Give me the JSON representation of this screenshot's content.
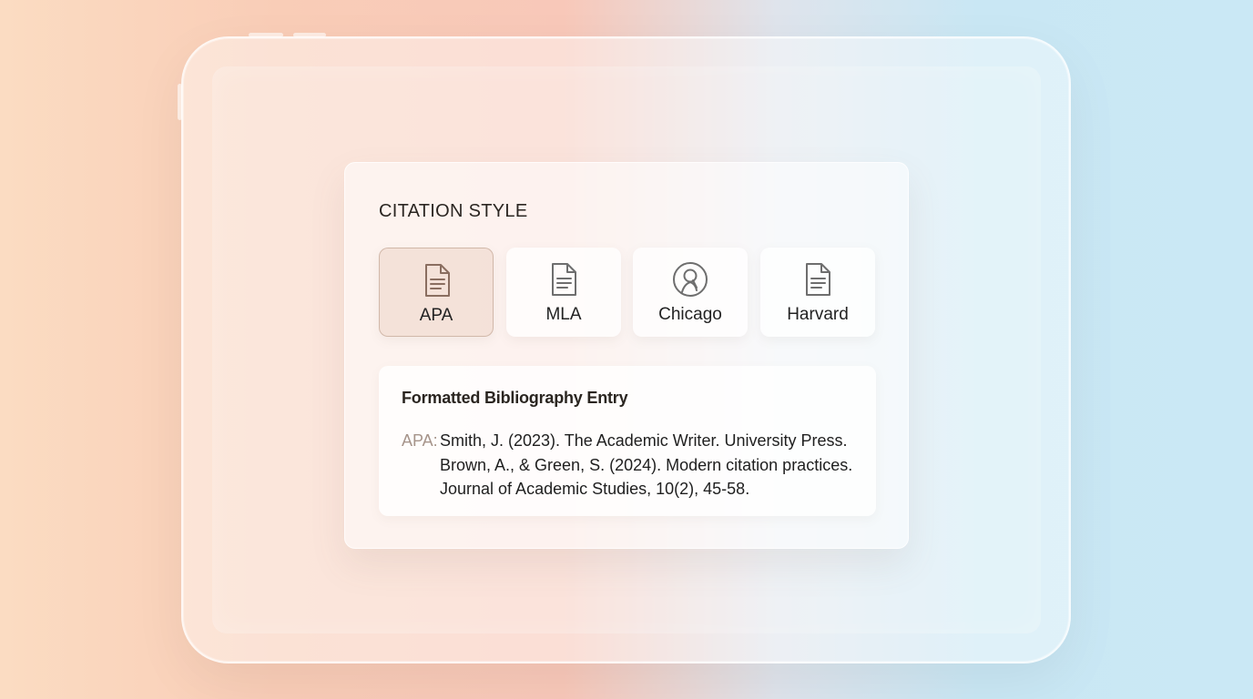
{
  "panel": {
    "title": "CITATION STYLE",
    "styles": [
      {
        "label": "APA",
        "icon": "document-icon",
        "selected": true
      },
      {
        "label": "MLA",
        "icon": "document-icon",
        "selected": false
      },
      {
        "label": "Chicago",
        "icon": "profile-circle-icon",
        "selected": false
      },
      {
        "label": "Harvard",
        "icon": "document-icon",
        "selected": false
      }
    ],
    "entry": {
      "heading": "Formatted Bibliography Entry",
      "prefix": "APA:",
      "lines": [
        "Smith, J. (2023). The Academic Writer. University Press.",
        "Brown, A., & Green, S. (2024). Modern citation practices.",
        "Journal of Academic Studies, 10(2), 45-58."
      ]
    }
  },
  "colors": {
    "selected_icon": "#8a6e60",
    "icon": "#6e6e6e",
    "prefix": "#a6948a"
  }
}
